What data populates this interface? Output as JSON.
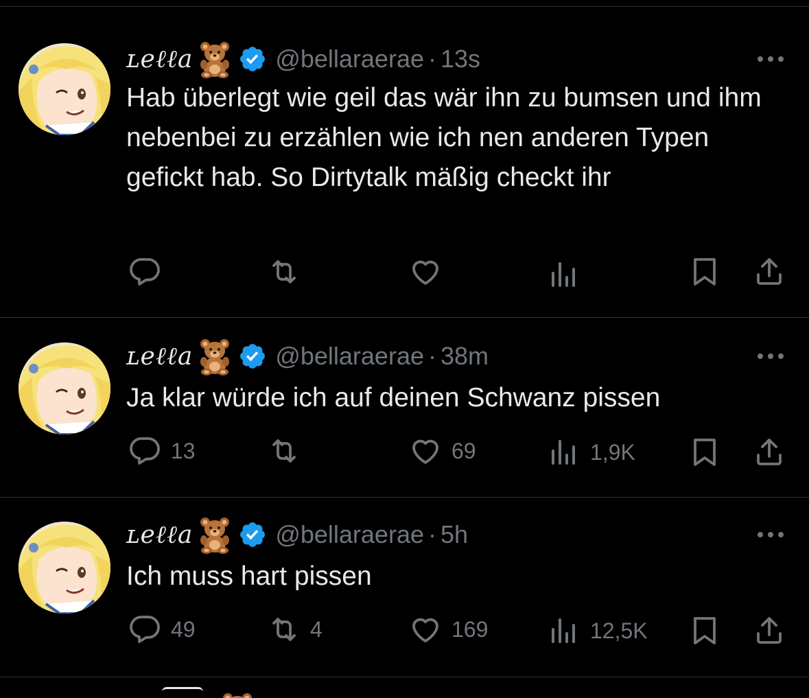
{
  "accent_color": "#1d9bf0",
  "text_color": "#e7e9ea",
  "muted_color": "#71767b",
  "tweets": [
    {
      "display_name": "ʟeℓℓa",
      "emoji": "teddy-bear",
      "verified": true,
      "handle": "@bellaraerae",
      "separator": "·",
      "time": "13s",
      "text": "Hab überlegt wie geil das wär ihn zu bumsen und ihm nebenbei zu erzählen wie ich nen anderen Typen gefickt hab. So Dirtytalk mäßig checkt ihr",
      "replies": "",
      "retweets": "",
      "likes": "",
      "views": ""
    },
    {
      "display_name": "ʟeℓℓa",
      "emoji": "teddy-bear",
      "verified": true,
      "handle": "@bellaraerae",
      "separator": "·",
      "time": "38m",
      "text": "Ja klar würde ich auf deinen Schwanz pissen",
      "replies": "13",
      "retweets": "",
      "likes": "69",
      "views": "1,9K"
    },
    {
      "display_name": "ʟeℓℓa",
      "emoji": "teddy-bear",
      "verified": true,
      "handle": "@bellaraerae",
      "separator": "·",
      "time": "5h",
      "text": "Ich muss hart pissen",
      "replies": "49",
      "retweets": "4",
      "likes": "169",
      "views": "12,5K"
    }
  ]
}
